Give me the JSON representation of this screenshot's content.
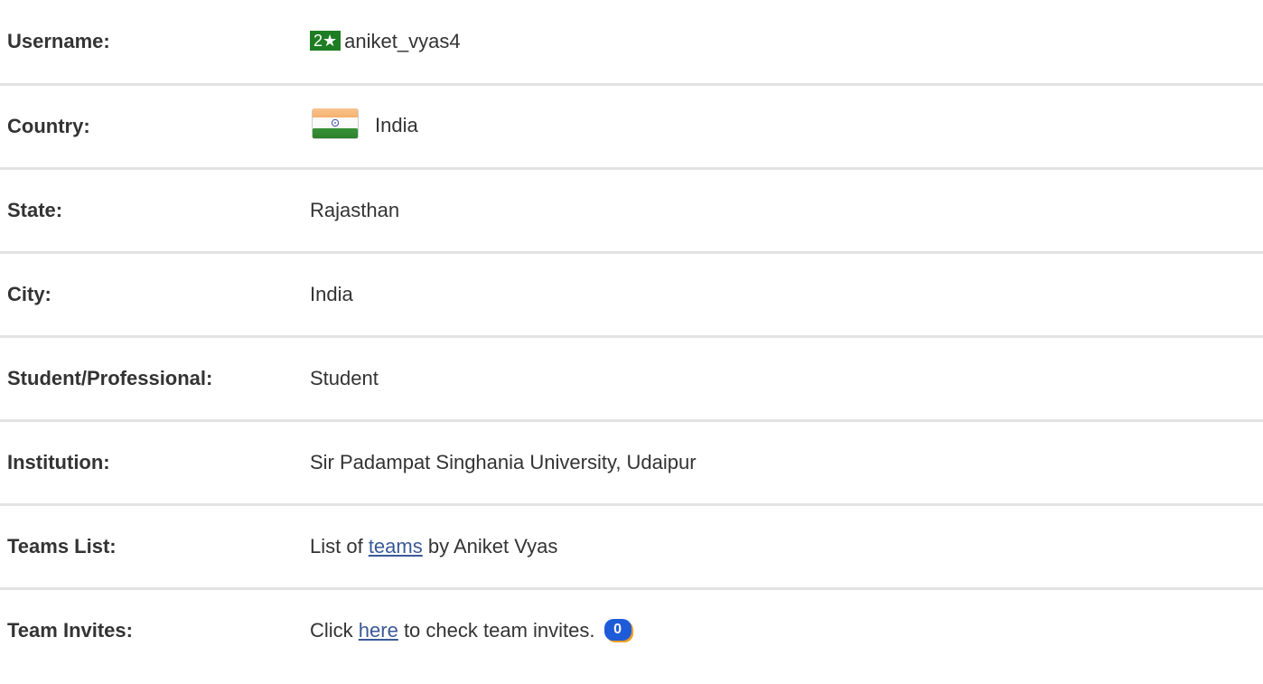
{
  "profile": {
    "username": {
      "label": "Username:",
      "rating": "2★",
      "value": "aniket_vyas4"
    },
    "country": {
      "label": "Country:",
      "flag_icon": "india-flag-icon",
      "value": "India"
    },
    "state": {
      "label": "State:",
      "value": "Rajasthan"
    },
    "city": {
      "label": "City:",
      "value": "India"
    },
    "occupation": {
      "label": "Student/Professional:",
      "value": "Student"
    },
    "institution": {
      "label": "Institution:",
      "value": "Sir Padampat Singhania University, Udaipur"
    },
    "teams_list": {
      "label": "Teams List:",
      "prefix": "List of ",
      "link": "teams",
      "suffix": " by Aniket Vyas"
    },
    "team_invites": {
      "label": "Team Invites:",
      "prefix": "Click ",
      "link": "here",
      "suffix": " to check team invites. ",
      "count": "0"
    }
  },
  "colors": {
    "rating_badge": "#1e7d22",
    "link": "#3b5998",
    "count_badge": "#1e5bd8",
    "divider": "#e3e3e3"
  }
}
